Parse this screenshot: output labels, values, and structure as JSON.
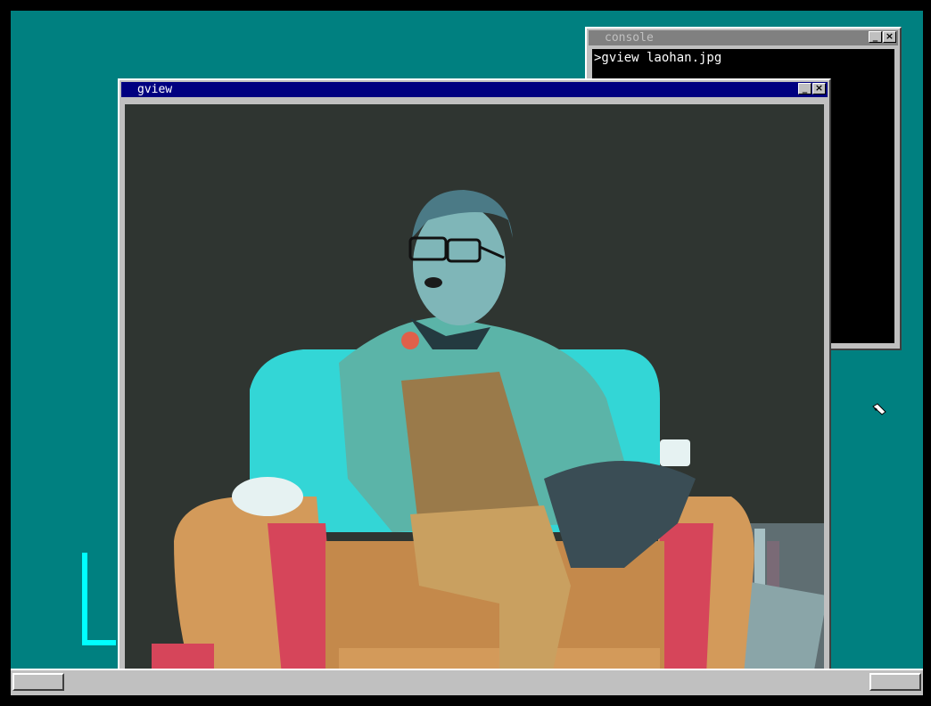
{
  "console": {
    "title": "console",
    "minimize": "_",
    "close": "×",
    "line": ">gview laohan.jpg"
  },
  "gview": {
    "title": "gview",
    "minimize": "_",
    "close": "×"
  },
  "colors": {
    "desktop": "#008080",
    "title_active": "#000080",
    "title_inactive": "#808080",
    "accent_line": "#00ffff"
  },
  "icons": [
    "minimize-icon",
    "close-icon",
    "mouse-pointer-icon"
  ]
}
